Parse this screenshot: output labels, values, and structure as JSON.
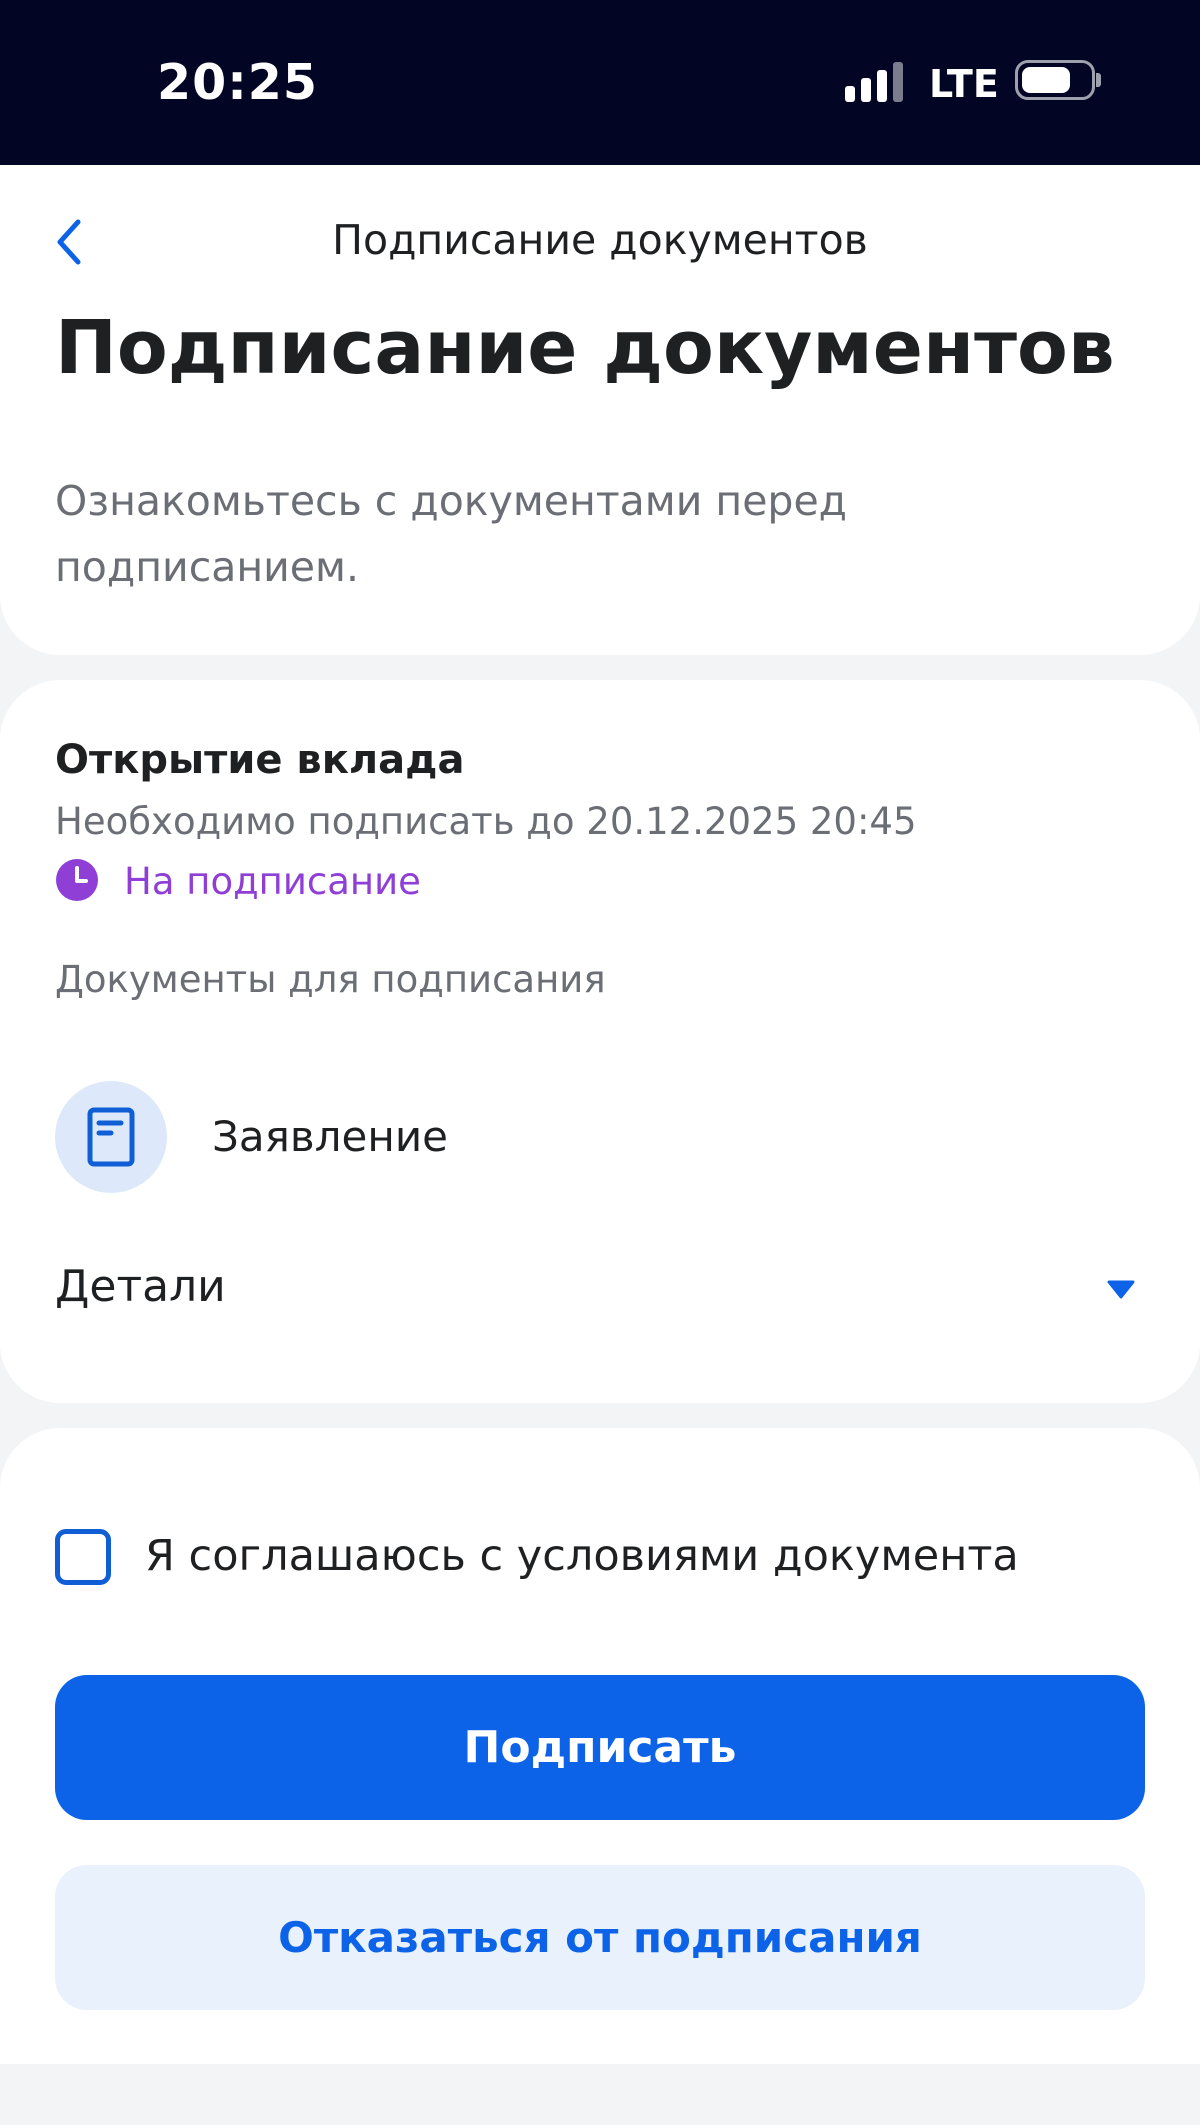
{
  "status_bar": {
    "time": "20:25",
    "network": "LTE",
    "icons": [
      "signal-icon",
      "battery-icon"
    ]
  },
  "header": {
    "nav_title": "Подписание документов",
    "back_icon": "chevron-left-icon",
    "title": "Подписание документов",
    "subtitle": "Ознакомьтесь с документами перед подписанием."
  },
  "operation": {
    "title": "Открытие вклада",
    "deadline": "Необходимо подписать до 20.12.2025 20:45",
    "status": "На подписание",
    "status_icon": "clock-icon",
    "documents_label": "Документы для подписания",
    "documents": [
      {
        "name": "Заявление",
        "icon": "document-icon"
      }
    ],
    "details_label": "Детали",
    "details_icon": "triangle-down-icon"
  },
  "actions": {
    "agree_label": "Я соглашаюсь с условиями документа",
    "agree_checked": false,
    "sign_label": "Подписать",
    "decline_label": "Отказаться от подписания"
  },
  "colors": {
    "accent": "#0c63e7",
    "status_purple": "#8f3fd6",
    "status_bar_bg": "#030524",
    "secondary_button_bg": "#e9f1fc"
  }
}
